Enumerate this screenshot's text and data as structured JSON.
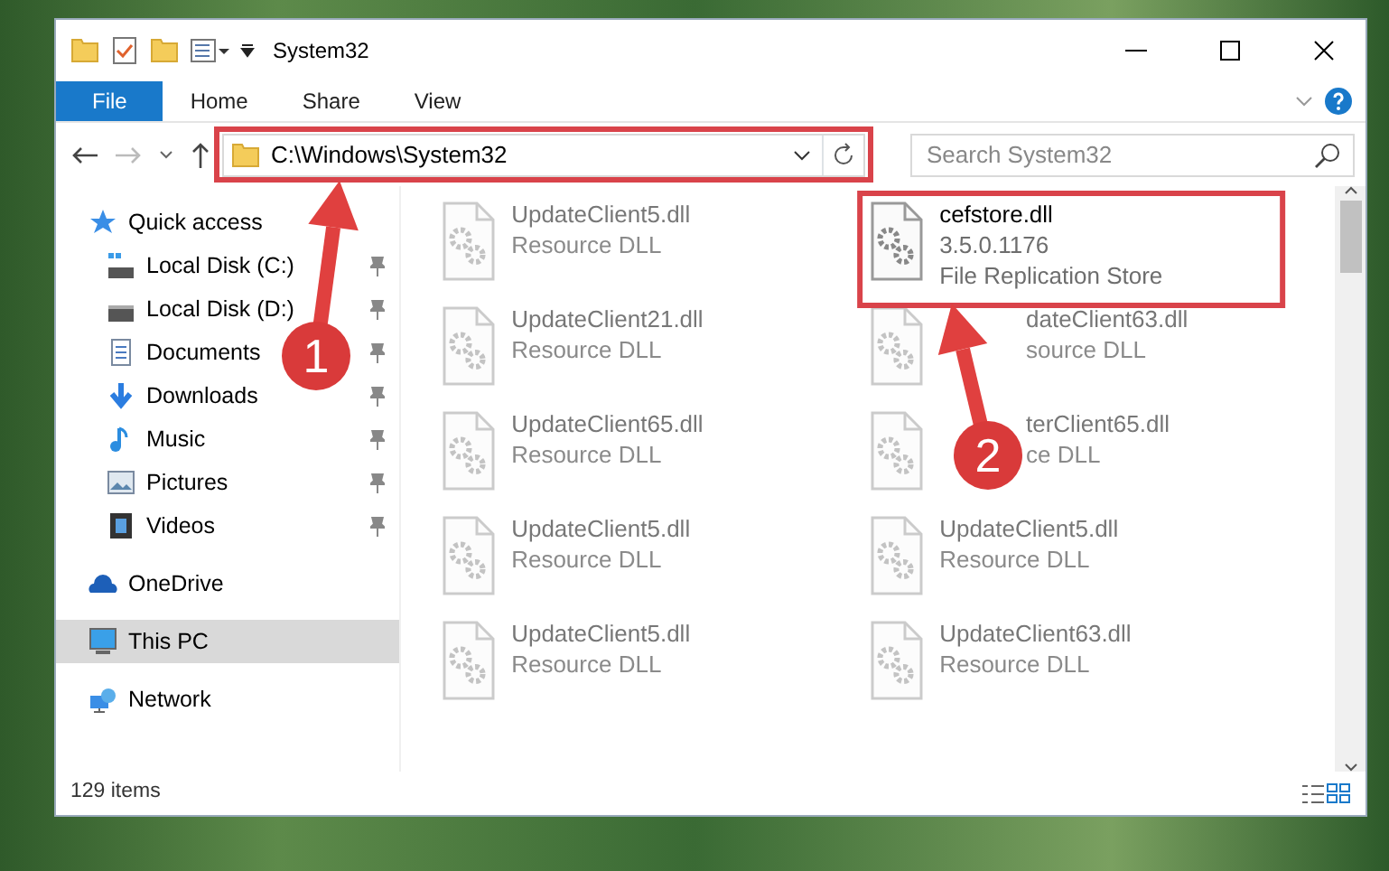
{
  "window": {
    "title": "System32"
  },
  "ribbon_tabs": [
    {
      "label": "File",
      "kind": "file-menu"
    },
    {
      "label": "Home",
      "kind": "tab"
    },
    {
      "label": "Share",
      "kind": "tab"
    },
    {
      "label": "View",
      "kind": "tab"
    }
  ],
  "address_bar": {
    "path": "C:\\Windows\\System32"
  },
  "search": {
    "placeholder": "Search System32"
  },
  "sidebar": {
    "items": [
      {
        "label": "Quick access",
        "kind": "star",
        "selected": false,
        "children": [
          {
            "label": "Local Disk (C:)",
            "kind": "system-drive",
            "selected": false,
            "pinned": true
          },
          {
            "label": "Local Disk (D:)",
            "kind": "drive",
            "selected": false,
            "pinned": true
          },
          {
            "label": "Documents",
            "kind": "documents",
            "selected": false,
            "pinned": true
          },
          {
            "label": "Downloads",
            "kind": "downloads",
            "selected": false,
            "pinned": true
          },
          {
            "label": "Music",
            "kind": "music",
            "selected": false,
            "pinned": true
          },
          {
            "label": "Pictures",
            "kind": "pictures",
            "selected": false,
            "pinned": true
          },
          {
            "label": "Videos",
            "kind": "videos",
            "selected": false,
            "pinned": true
          }
        ]
      },
      {
        "label": "OneDrive",
        "kind": "cloud",
        "selected": false
      },
      {
        "label": "This PC",
        "kind": "computer",
        "selected": true
      },
      {
        "label": "Network",
        "kind": "network",
        "selected": false
      }
    ]
  },
  "files": [
    {
      "name": "UpdateClient5.dll",
      "description": "Resource DLL",
      "dimmed": true
    },
    {
      "name": "cefstore.dll",
      "version": "3.5.0.1176",
      "description": "File Replication Store",
      "dimmed": false,
      "highlighted": true
    },
    {
      "name": "UpdateClient21.dll",
      "description": "Resource DLL",
      "dimmed": true
    },
    {
      "name": "dateClient63.dll",
      "description": "source DLL",
      "dimmed": true
    },
    {
      "name": "UpdateClient65.dll",
      "description": "Resource DLL",
      "dimmed": true
    },
    {
      "name": "terClient65.dll",
      "description": "ce DLL",
      "dimmed": true
    },
    {
      "name": "UpdateClient5.dll",
      "description": "Resource DLL",
      "dimmed": true
    },
    {
      "name": "UpdateClient5.dll",
      "description": "Resource DLL",
      "dimmed": true
    },
    {
      "name": "UpdateClient5.dll",
      "description": "Resource DLL",
      "dimmed": true
    },
    {
      "name": "UpdateClient63.dll",
      "description": "Resource DLL",
      "dimmed": true
    }
  ],
  "status_bar": {
    "item_count": "129 items"
  },
  "annotations": [
    {
      "label": "1"
    },
    {
      "label": "2"
    }
  ]
}
